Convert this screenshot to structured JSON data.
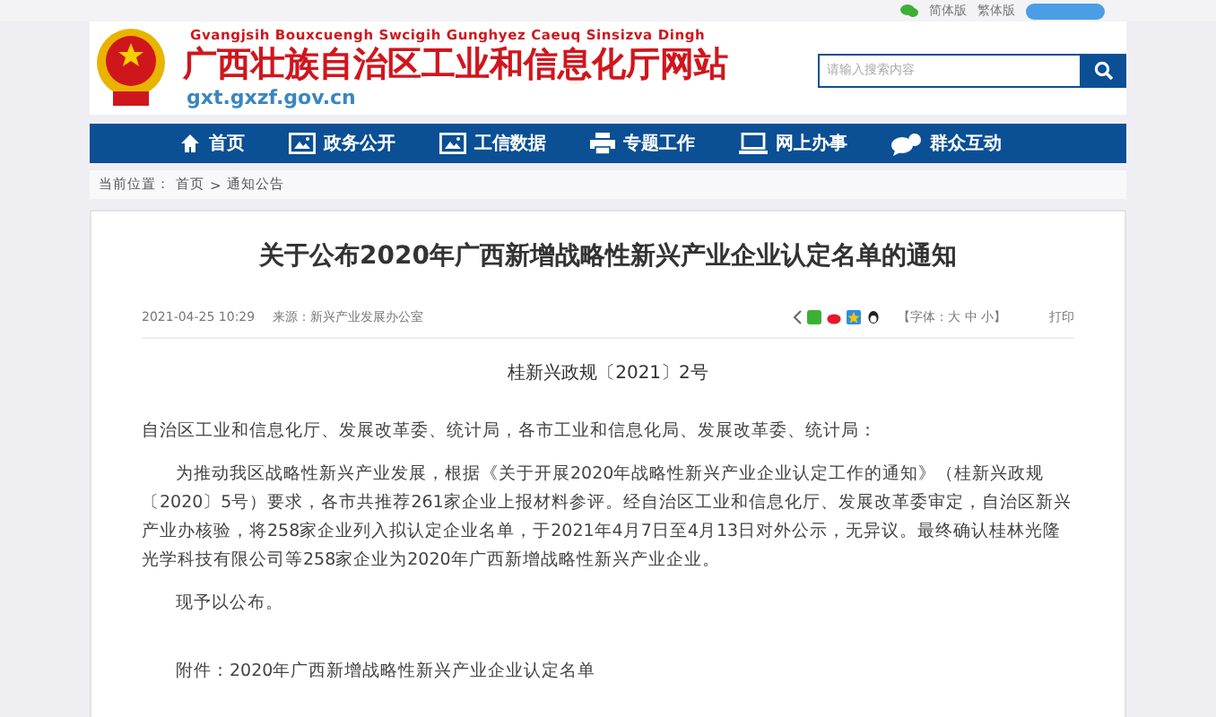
{
  "top_bar": {
    "links": [
      "简体版",
      "繁体版"
    ]
  },
  "header": {
    "pinyin_name": "Gvangjsih Bouxcuengh Swcigih Gunghyez Caeuq Sinsizva Dingh",
    "site_name": "广西壮族自治区工业和信息化厅网站",
    "domain": "gxt.gxzf.gov.cn",
    "search": {
      "placeholder": "请输入搜索内容"
    }
  },
  "nav": [
    {
      "label": "首页",
      "kind": "home"
    },
    {
      "label": "政务公开",
      "kind": "image"
    },
    {
      "label": "工信数据",
      "kind": "image"
    },
    {
      "label": "专题工作",
      "kind": "printer"
    },
    {
      "label": "网上办事",
      "kind": "laptop"
    },
    {
      "label": "群众互动",
      "kind": "chat"
    }
  ],
  "breadcrumb": {
    "prefix": "当前位置：",
    "items": [
      "首页",
      "通知公告"
    ],
    "separator": ">"
  },
  "article": {
    "title": "关于公布2020年广西新增战略性新兴产业企业认定名单的通知",
    "date": "2021-04-25 10:29",
    "source": "来源：新兴产业发展办公室",
    "font_size": "【字体：大 中 小】",
    "print": "打印",
    "doc_number": "桂新兴政规〔2021〕2号",
    "paragraphs": [
      {
        "text": "自治区工业和信息化厅、发展改革委、统计局，各市工业和信息化局、发展改革委、统计局：",
        "indent": false
      },
      {
        "text": "为推动我区战略性新兴产业发展，根据《关于开展2020年战略性新兴产业企业认定工作的通知》（桂新兴政规〔2020〕5号）要求，各市共推荐261家企业上报材料参评。经自治区工业和信息化厅、发展改革委审定，自治区新兴产业办核验，将258家企业列入拟认定企业名单，于2021年4月7日至4月13日对外公示，无异议。最终确认桂林光隆光学科技有限公司等258家企业为2020年广西新增战略性新兴产业企业。",
        "indent": true
      },
      {
        "text": "现予以公布。",
        "indent": true
      },
      {
        "text": "附件：2020年广西新增战略性新兴产业企业认定名单",
        "indent": true
      }
    ]
  }
}
